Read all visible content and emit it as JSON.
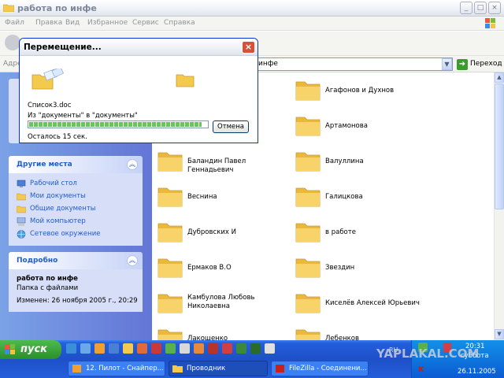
{
  "window": {
    "title": "работа по инфе",
    "controls": {
      "minimize": "_",
      "maximize": "□",
      "close": "×"
    }
  },
  "menu": [
    "Файл",
    "Правка",
    "Вид",
    "Избранное",
    "Сервис",
    "Справка"
  ],
  "address": {
    "label": "Адре",
    "value": "инфе",
    "go_label": "Переход"
  },
  "sidebar": {
    "other_places": {
      "title": "Другие места",
      "items": [
        {
          "label": "Рабочий стол",
          "icon": "desktop-icon"
        },
        {
          "label": "Мои документы",
          "icon": "documents-folder-icon"
        },
        {
          "label": "Общие документы",
          "icon": "shared-folder-icon"
        },
        {
          "label": "Мой компьютер",
          "icon": "computer-icon"
        },
        {
          "label": "Сетевое окружение",
          "icon": "network-icon"
        }
      ]
    },
    "details": {
      "title": "Подробно",
      "name": "работа по инфе",
      "type": "Папка с файлами",
      "modified": "Изменен: 26 ноября 2005 г., 20:29"
    }
  },
  "folders": {
    "right": [
      "Агафонов и Духнов",
      "Артамонова",
      "Валуллина",
      "Галицкова",
      "в работе",
      "Звездин",
      "Киселёв Алексей Юрьевич",
      "Лебенков"
    ],
    "left": [
      "Баландин Павел Геннадьевич",
      "Веснина",
      "Дубровских И",
      "Ермаков В.О",
      "Камбулова Любовь Николаевна",
      "Лакощенко"
    ]
  },
  "dialog": {
    "title": "Перемещение...",
    "file": "Список3.doc",
    "from_to": "Из \"документы\" в \"документы\"",
    "progress": 0.97,
    "cancel_label": "Отмена",
    "time_left": "Осталось 15 сек."
  },
  "taskbar": {
    "start_label": "пуск",
    "tasks": [
      {
        "label": "12. Пилот - Снайпер...",
        "active": false
      },
      {
        "label": "Проводник",
        "active": true
      },
      {
        "label": "FileZilla - Соединени...",
        "active": false
      }
    ],
    "tray": {
      "lang": "RU",
      "time": "20:31",
      "day": "суббота",
      "date": "26.11.2005"
    }
  },
  "watermark": "YAPLAKAL.COM",
  "colors": {
    "accent": "#215dc6",
    "folder": "#f5cf5a",
    "progress": "#63c75a"
  }
}
